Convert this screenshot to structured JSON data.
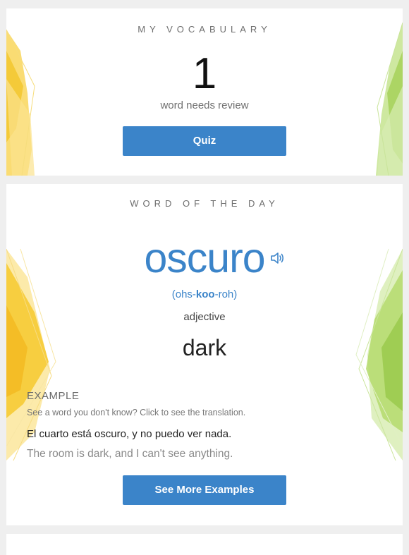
{
  "vocabulary": {
    "title": "MY VOCABULARY",
    "count": "1",
    "caption": "word needs review",
    "quiz_label": "Quiz"
  },
  "word_of_the_day": {
    "title": "WORD OF THE DAY",
    "word": "oscuro",
    "pronunciation": {
      "before": "(ohs-",
      "stress": "koo",
      "after": "-roh)"
    },
    "part_of_speech": "adjective",
    "translation": "dark",
    "speaker_icon": "speaker-icon",
    "example": {
      "label": "EXAMPLE",
      "hint": "See a word you don't know? Click to see the translation.",
      "spanish_words": [
        "El",
        "cuarto",
        "está",
        "oscuro,",
        "y",
        "no",
        "puedo",
        "ver",
        "nada."
      ],
      "english": "The room is dark, and I can't see anything."
    },
    "more_examples_label": "See More Examples"
  },
  "colors": {
    "accent": "#3b84c9",
    "yellow_decoration": "#f7cf3c",
    "green_decoration": "#a9d35a",
    "page_background": "#efefef"
  }
}
